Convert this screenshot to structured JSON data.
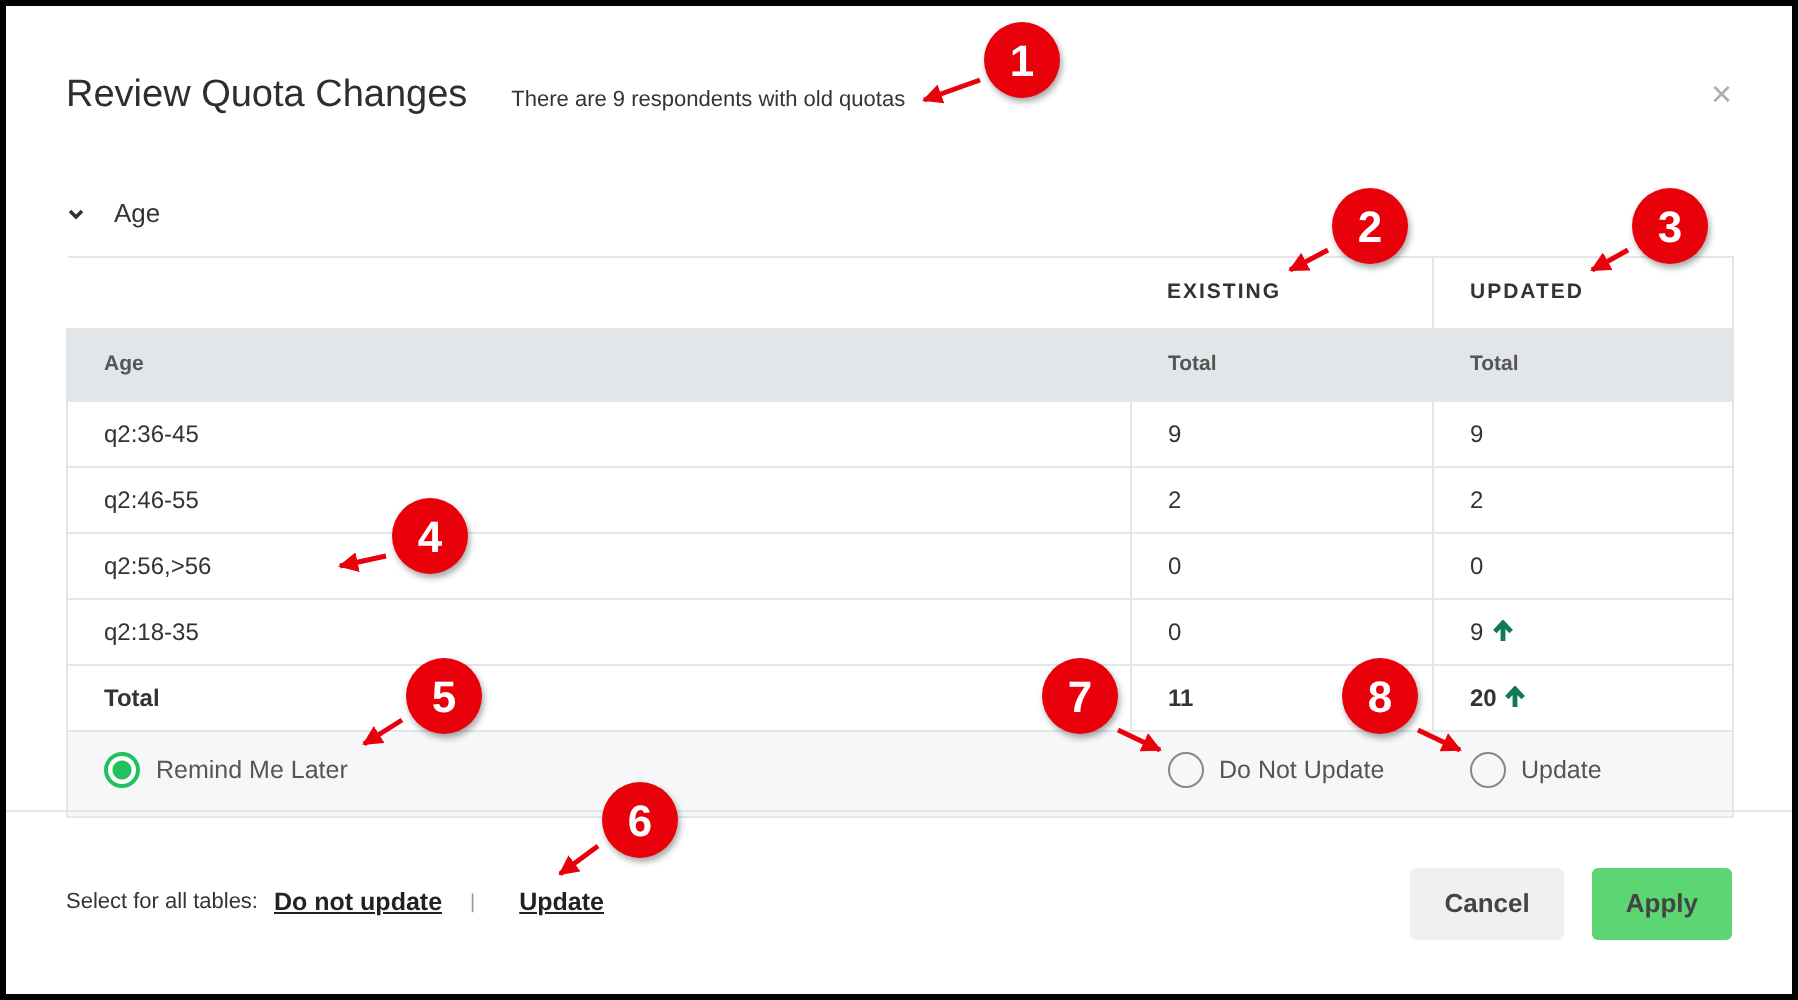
{
  "dialog": {
    "title": "Review Quota Changes",
    "subtitle": "There are 9 respondents with old quotas",
    "close": "×"
  },
  "section": {
    "label": "Age",
    "expanded": true
  },
  "table": {
    "group_headers": [
      "EXISTING",
      "UPDATED"
    ],
    "columns": [
      "Age",
      "Total",
      "Total"
    ],
    "rows": [
      {
        "label": "q2:36-45",
        "existing": "9",
        "updated": "9",
        "increased": false,
        "total": false
      },
      {
        "label": "q2:46-55",
        "existing": "2",
        "updated": "2",
        "increased": false,
        "total": false
      },
      {
        "label": "q2:56,>56",
        "existing": "0",
        "updated": "0",
        "increased": false,
        "total": false
      },
      {
        "label": "q2:18-35",
        "existing": "0",
        "updated": "9",
        "increased": true,
        "total": false
      },
      {
        "label": "Total",
        "existing": "11",
        "updated": "20",
        "increased": true,
        "total": true
      }
    ],
    "options": [
      {
        "label": "Remind Me Later",
        "selected": true
      },
      {
        "label": "Do Not Update",
        "selected": false
      },
      {
        "label": "Update",
        "selected": false
      }
    ]
  },
  "footer": {
    "prompt": "Select for all tables:",
    "links": [
      "Do not update",
      "Update"
    ],
    "separator": "|",
    "buttons": [
      {
        "label": "Cancel",
        "kind": "secondary"
      },
      {
        "label": "Apply",
        "kind": "primary"
      }
    ]
  },
  "callouts": [
    {
      "label": "1"
    },
    {
      "label": "2"
    },
    {
      "label": "3"
    },
    {
      "label": "4"
    },
    {
      "label": "5"
    },
    {
      "label": "6"
    },
    {
      "label": "7"
    },
    {
      "label": "8"
    }
  ]
}
